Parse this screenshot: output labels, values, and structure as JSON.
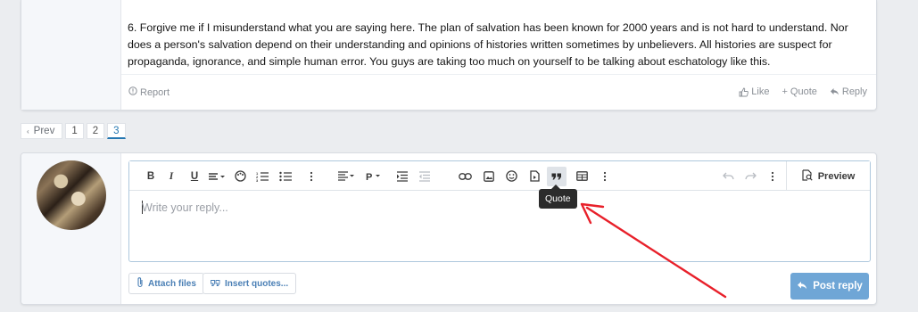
{
  "post": {
    "body": "6. Forgive me if I misunderstand what you are saying here. The plan of salvation has been known for 2000 years and is not hard to understand. Nor does a person's salvation depend on their understanding and opinions of histories written sometimes by unbelievers. All histories are suspect for propaganda, ignorance, and simple human error. You guys are taking too much on yourself to be talking about eschatology like this.",
    "report_label": "Report",
    "like_label": "Like",
    "quote_label": "Quote",
    "reply_label": "Reply"
  },
  "pagination": {
    "prev_label": "Prev",
    "pages": [
      "1",
      "2",
      "3"
    ],
    "current": "3"
  },
  "editor": {
    "placeholder": "Write your reply...",
    "preview_label": "Preview",
    "tooltip": "Quote",
    "toolbar_icons": [
      "bold-icon",
      "italic-icon",
      "underline-icon",
      "text-style-icon",
      "color-icon",
      "ordered-list-icon",
      "unordered-list-icon",
      "more-icon",
      "align-icon",
      "paragraph-icon",
      "indent-icon",
      "outdent-icon",
      "link-icon",
      "image-icon",
      "smilie-icon",
      "media-icon",
      "quote-icon",
      "table-icon",
      "more-icon",
      "undo-icon",
      "redo-icon",
      "more-icon",
      "preview-icon"
    ]
  },
  "buttons": {
    "attach_files": "Attach files",
    "insert_quotes": "Insert quotes...",
    "post_reply": "Post reply"
  },
  "colors": {
    "accent": "#2577b1",
    "post_reply_bg": "#6fa6d6",
    "annotation_arrow": "#e8202a"
  }
}
